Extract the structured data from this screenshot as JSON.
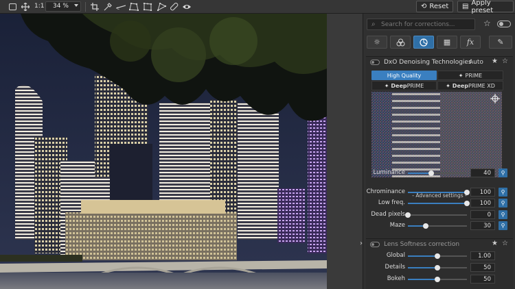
{
  "toolbar": {
    "zoom_1to1": "1:1",
    "zoom_value": "34 %",
    "reset_label": "Reset",
    "apply_preset_label": "Apply preset",
    "icons": [
      "crop-mode-icon",
      "move-icon",
      "crop-icon",
      "eyedropper-icon",
      "horizon-icon",
      "perspective-icon",
      "perspective-8pt-icon",
      "local-adjust-icon",
      "repair-icon",
      "eye-icon",
      "undo-icon",
      "preset-icon"
    ]
  },
  "panel": {
    "search_placeholder": "Search for corrections...",
    "tabs": [
      "light-icon",
      "color-icon",
      "detail-icon",
      "geometry-icon",
      "effects-icon",
      "edit-icon"
    ],
    "active_tab": 2,
    "denoise": {
      "title": "DxO Denoising Technologies",
      "auto_label": "Auto",
      "modes": [
        {
          "label": "High Quality",
          "active": true
        },
        {
          "label": "PRIME",
          "active": false
        },
        {
          "bold": "Deep",
          "rest": "PRIME",
          "active": false
        },
        {
          "bold": "Deep",
          "rest": "PRIME XD",
          "active": false
        }
      ],
      "advanced_label": "- Advanced settings -",
      "sliders": [
        {
          "label": "Luminance",
          "value": "40",
          "fraction": 0.4
        },
        {
          "label": "Chrominance",
          "value": "100",
          "fraction": 1.0
        },
        {
          "label": "Low freq.",
          "value": "100",
          "fraction": 1.0
        },
        {
          "label": "Dead pixels",
          "value": "0",
          "fraction": 0.0
        },
        {
          "label": "Maze",
          "value": "30",
          "fraction": 0.3
        }
      ]
    },
    "lens_softness": {
      "title": "Lens Softness correction",
      "sliders": [
        {
          "label": "Global",
          "value": "1.00",
          "fraction": 0.5
        },
        {
          "label": "Details",
          "value": "50",
          "fraction": 0.5
        },
        {
          "label": "Bokeh",
          "value": "50",
          "fraction": 0.5
        }
      ]
    }
  },
  "colors": {
    "accent": "#3a7fc0",
    "panel_bg": "#303030",
    "toolbar_bg": "#363636"
  }
}
